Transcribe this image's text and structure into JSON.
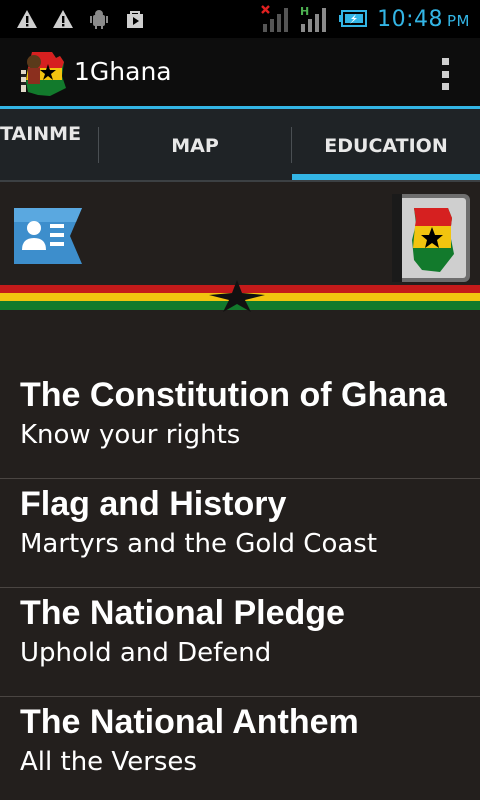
{
  "status_bar": {
    "time": "10:48",
    "ampm": "PM",
    "left_icons": [
      "warning-icon",
      "warning-icon",
      "android-debug-icon",
      "shopping-bag-icon"
    ],
    "right_icons": [
      "signal-no-service-icon",
      "signal-hplus-icon",
      "battery-charging-icon"
    ],
    "network_label": "H",
    "accent_color": "#33b5e5"
  },
  "action_bar": {
    "title": "1Ghana",
    "logo_icon": "ghana-map-logo-icon",
    "overflow_icon": "overflow-menu-icon"
  },
  "tabs": {
    "items": [
      {
        "label": "TAINME"
      },
      {
        "label": "MAP"
      },
      {
        "label": "EDUCATION"
      }
    ],
    "selected_index": 2
  },
  "header": {
    "contact_icon": "contact-card-icon",
    "map_icon": "ghana-flag-map-book-icon",
    "stripe_colors": [
      "#c41a1a",
      "#f2c40f",
      "#127a2c"
    ]
  },
  "list": {
    "items": [
      {
        "title": "The Constitution of Ghana",
        "subtitle": "Know your rights"
      },
      {
        "title": "Flag and History",
        "subtitle": "Martyrs and the Gold Coast"
      },
      {
        "title": "The National Pledge",
        "subtitle": "Uphold and Defend"
      },
      {
        "title": "The National Anthem",
        "subtitle": "All the Verses"
      }
    ]
  }
}
